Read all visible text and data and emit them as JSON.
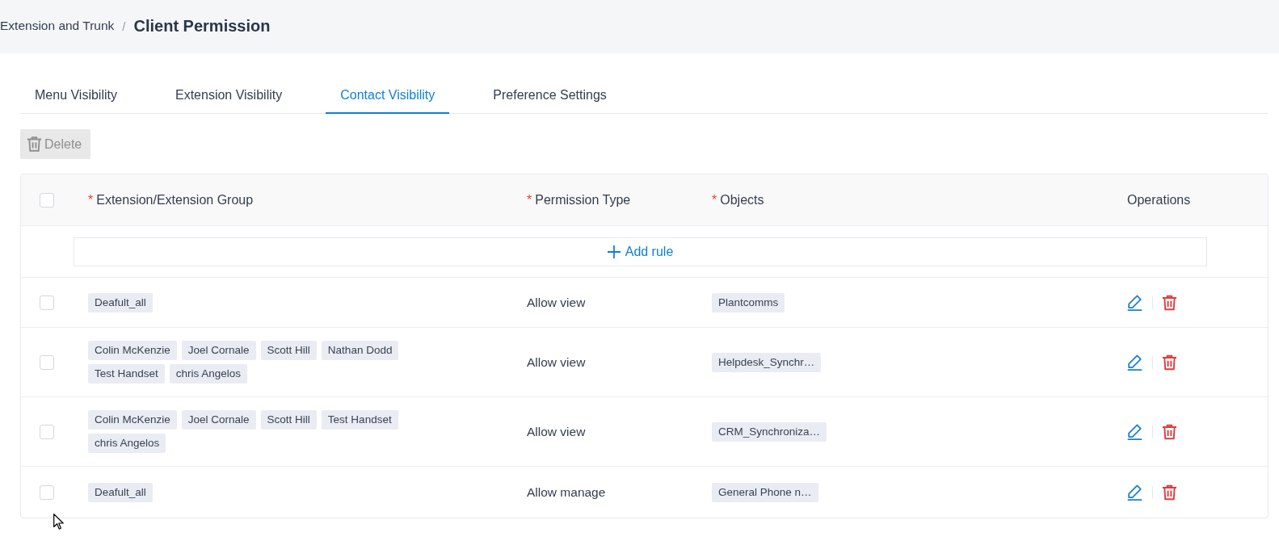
{
  "breadcrumb": {
    "parent": "Extension and Trunk",
    "separator": "/",
    "current": "Client Permission"
  },
  "tabs": [
    {
      "label": "Menu Visibility",
      "selected": false
    },
    {
      "label": "Extension Visibility",
      "selected": false
    },
    {
      "label": "Contact Visibility",
      "selected": true
    },
    {
      "label": "Preference Settings",
      "selected": false
    }
  ],
  "toolbar": {
    "delete_button": {
      "label": "Delete",
      "disabled": true
    }
  },
  "table": {
    "select_all": {
      "checked": false
    },
    "columns": [
      {
        "label": "Extension/Extension Group",
        "required_mark": "*"
      },
      {
        "label": "Permission Type",
        "required_mark": "*"
      },
      {
        "label": "Objects",
        "required_mark": "*"
      },
      {
        "label": "Operations"
      }
    ],
    "add_rule": {
      "label": "Add rule"
    },
    "rows": [
      {
        "checked": false,
        "extensions": [
          "Deafult_all"
        ],
        "permission_type": "Allow view",
        "objects": [
          "Plantcomms"
        ]
      },
      {
        "checked": false,
        "extensions": [
          "Colin McKenzie",
          "Joel Cornale",
          "Scott Hill",
          "Nathan Dodd",
          "Test Handset",
          "chris Angelos"
        ],
        "permission_type": "Allow view",
        "objects": [
          "Helpdesk_Synchr…"
        ]
      },
      {
        "checked": false,
        "extensions": [
          "Colin McKenzie",
          "Joel Cornale",
          "Scott Hill",
          "Test Handset",
          "chris Angelos"
        ],
        "permission_type": "Allow view",
        "objects": [
          "CRM_Synchroniza…"
        ]
      },
      {
        "checked": false,
        "extensions": [
          "Deafult_all"
        ],
        "permission_type": "Allow manage",
        "objects": [
          "General Phone n…"
        ]
      }
    ]
  }
}
